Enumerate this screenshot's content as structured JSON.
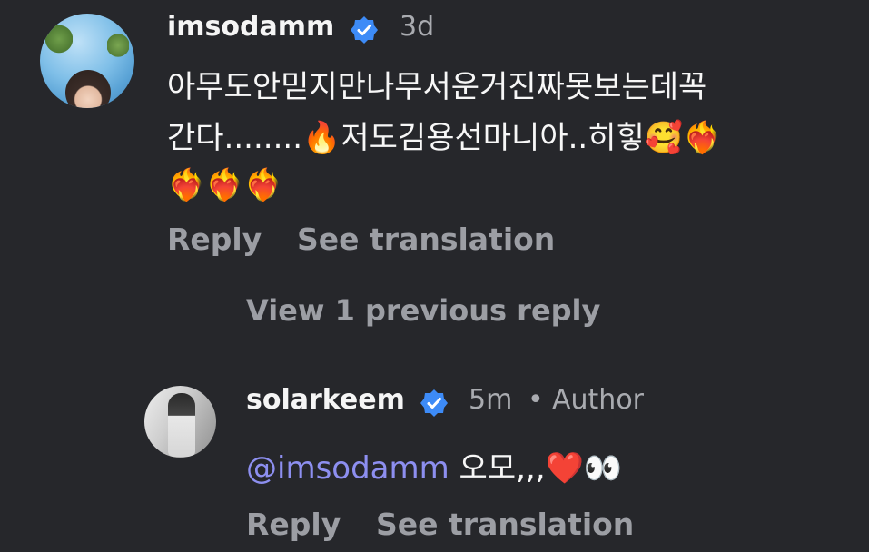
{
  "comments": [
    {
      "username": "imsodamm",
      "time": "3d",
      "text_line1": "아무도안믿지만나무서운거진짜못보는데꼭",
      "text_line2": "간다........🔥저도김용선마니아..히힣🥰❤️‍🔥",
      "text_line3": "❤️‍🔥❤️‍🔥❤️‍🔥",
      "reply_label": "Reply",
      "translate_label": "See translation",
      "verified_icon": "verified-badge-icon"
    },
    {
      "username": "solarkeem",
      "time": "5m",
      "separator": "•",
      "author_label": "Author",
      "mention": "@imsodamm",
      "text": " 오모,,,❤️👀",
      "reply_label": "Reply",
      "translate_label": "See translation",
      "verified_icon": "verified-badge-icon"
    }
  ],
  "view_previous": "View 1 previous reply",
  "colors": {
    "background": "#26272b",
    "verified": "#3d8bf7",
    "mention": "#8d8ff0",
    "muted": "#9c9ea4"
  }
}
